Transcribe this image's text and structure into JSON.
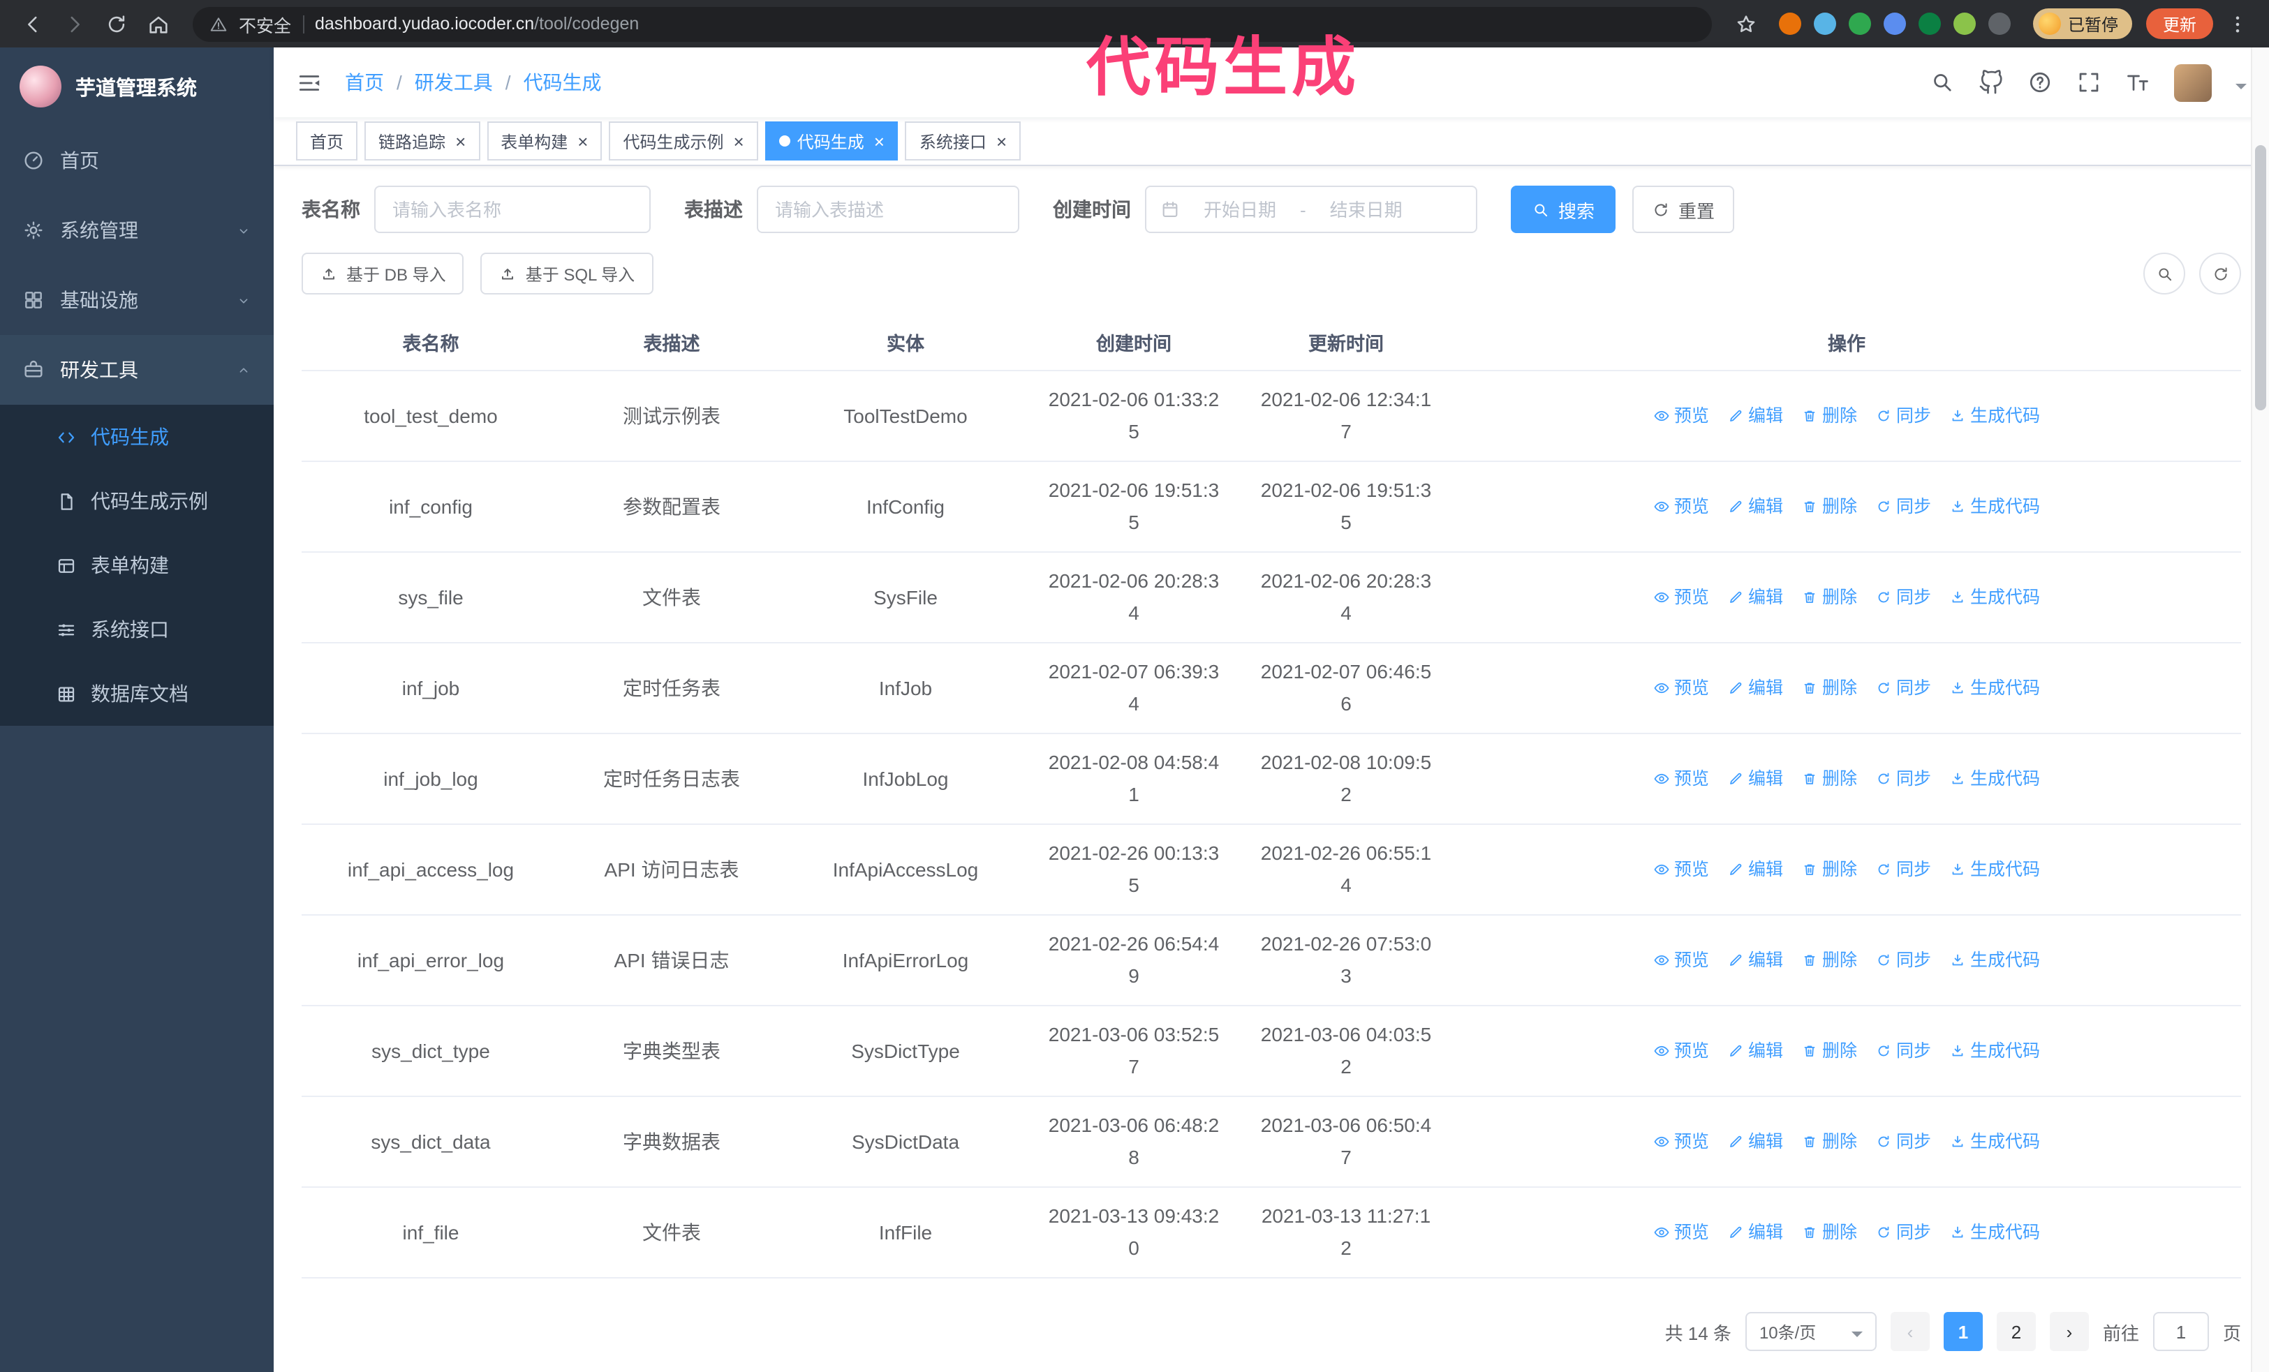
{
  "browser": {
    "warning_label": "不安全",
    "url_domain": "dashboard.yudao.iocoder.cn",
    "url_path": "/tool/codegen",
    "profile_badge": "已暂停",
    "update_button": "更新",
    "extensions": [
      "#e8710a",
      "#58b4e6",
      "#2fa84f",
      "#5b8def",
      "#0b8043",
      "#8bc34a",
      "#5f6368"
    ]
  },
  "annotation": {
    "text": "代码生成"
  },
  "sidebar": {
    "logo_title": "芋道管理系统",
    "items": [
      {
        "label": "首页"
      },
      {
        "label": "系统管理"
      },
      {
        "label": "基础设施"
      },
      {
        "label": "研发工具"
      }
    ],
    "subitems": [
      {
        "label": "代码生成"
      },
      {
        "label": "代码生成示例"
      },
      {
        "label": "表单构建"
      },
      {
        "label": "系统接口"
      },
      {
        "label": "数据库文档"
      }
    ]
  },
  "navbar": {
    "breadcrumb": [
      "首页",
      "研发工具",
      "代码生成"
    ]
  },
  "tabs": [
    {
      "id": "home",
      "label": "首页",
      "closable": false,
      "active": false
    },
    {
      "id": "trace",
      "label": "链路追踪",
      "closable": true,
      "active": false
    },
    {
      "id": "form-builder",
      "label": "表单构建",
      "closable": true,
      "active": false
    },
    {
      "id": "codegen-example",
      "label": "代码生成示例",
      "closable": true,
      "active": false
    },
    {
      "id": "codegen",
      "label": "代码生成",
      "closable": true,
      "active": true
    },
    {
      "id": "api",
      "label": "系统接口",
      "closable": true,
      "active": false
    }
  ],
  "filters": {
    "table_name_label": "表名称",
    "table_name_placeholder": "请输入表名称",
    "table_desc_label": "表描述",
    "table_desc_placeholder": "请输入表描述",
    "create_time_label": "创建时间",
    "date_start_placeholder": "开始日期",
    "date_separator": "-",
    "date_end_placeholder": "结束日期",
    "search_button": "搜索",
    "reset_button": "重置"
  },
  "toolbar": {
    "import_db_button": "基于 DB 导入",
    "import_sql_button": "基于 SQL 导入"
  },
  "table": {
    "columns": [
      "表名称",
      "表描述",
      "实体",
      "创建时间",
      "更新时间",
      "操作"
    ],
    "actions": [
      "预览",
      "编辑",
      "删除",
      "同步",
      "生成代码"
    ],
    "rows": [
      {
        "name": "tool_test_demo",
        "desc": "测试示例表",
        "entity": "ToolTestDemo",
        "created": "2021-02-06 01:33:25",
        "updated": "2021-02-06 12:34:17"
      },
      {
        "name": "inf_config",
        "desc": "参数配置表",
        "entity": "InfConfig",
        "created": "2021-02-06 19:51:35",
        "updated": "2021-02-06 19:51:35"
      },
      {
        "name": "sys_file",
        "desc": "文件表",
        "entity": "SysFile",
        "created": "2021-02-06 20:28:34",
        "updated": "2021-02-06 20:28:34"
      },
      {
        "name": "inf_job",
        "desc": "定时任务表",
        "entity": "InfJob",
        "created": "2021-02-07 06:39:34",
        "updated": "2021-02-07 06:46:56"
      },
      {
        "name": "inf_job_log",
        "desc": "定时任务日志表",
        "entity": "InfJobLog",
        "created": "2021-02-08 04:58:41",
        "updated": "2021-02-08 10:09:52"
      },
      {
        "name": "inf_api_access_log",
        "desc": "API 访问日志表",
        "entity": "InfApiAccessLog",
        "created": "2021-02-26 00:13:35",
        "updated": "2021-02-26 06:55:14"
      },
      {
        "name": "inf_api_error_log",
        "desc": "API 错误日志",
        "entity": "InfApiErrorLog",
        "created": "2021-02-26 06:54:49",
        "updated": "2021-02-26 07:53:03"
      },
      {
        "name": "sys_dict_type",
        "desc": "字典类型表",
        "entity": "SysDictType",
        "created": "2021-03-06 03:52:57",
        "updated": "2021-03-06 04:03:52"
      },
      {
        "name": "sys_dict_data",
        "desc": "字典数据表",
        "entity": "SysDictData",
        "created": "2021-03-06 06:48:28",
        "updated": "2021-03-06 06:50:47"
      },
      {
        "name": "inf_file",
        "desc": "文件表",
        "entity": "InfFile",
        "created": "2021-03-13 09:43:20",
        "updated": "2021-03-13 11:27:12"
      }
    ]
  },
  "pagination": {
    "total": "共 14 条",
    "page_size": "10条/页",
    "prev": "‹",
    "pages": [
      "1",
      "2"
    ],
    "next": "›",
    "goto_label": "前往",
    "goto_value": "1",
    "page_label": "页"
  },
  "colors": {
    "accent": "#409eff",
    "sidebar_bg": "#304156",
    "submenu_bg": "#1f2d3d",
    "annotation": "#fb4077"
  }
}
